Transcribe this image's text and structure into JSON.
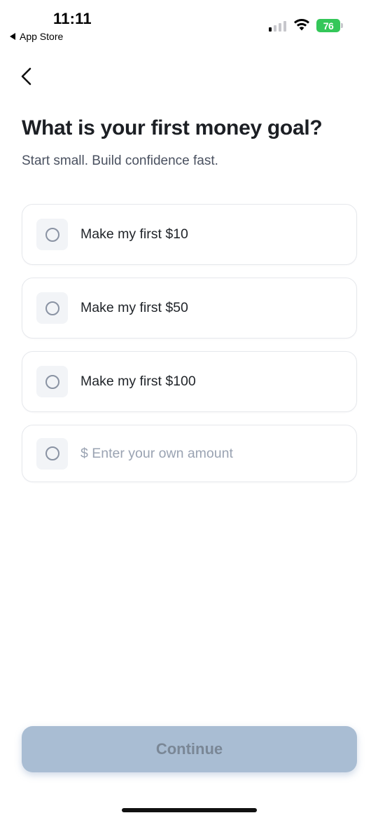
{
  "status_bar": {
    "time": "11:11",
    "back_app": "App Store",
    "battery": "76",
    "signal_bars_active": 1,
    "signal_bars_total": 4
  },
  "header": {
    "title": "What is your first money goal?",
    "subtitle": "Start small. Build confidence fast."
  },
  "options": [
    {
      "label": "Make my first $10",
      "selected": false
    },
    {
      "label": "Make my first $50",
      "selected": false
    },
    {
      "label": "Make my first $100",
      "selected": false
    }
  ],
  "custom_amount": {
    "placeholder": "$ Enter your own amount",
    "value": ""
  },
  "footer": {
    "continue_label": "Continue",
    "continue_enabled": false
  },
  "colors": {
    "accent_disabled": "#a9bdd3",
    "battery": "#34c759",
    "text_primary": "#1c1f24",
    "text_secondary": "#4a5160"
  },
  "icons": {
    "nav_back": "chevron-left-icon",
    "radio": "radio-unchecked-icon"
  }
}
